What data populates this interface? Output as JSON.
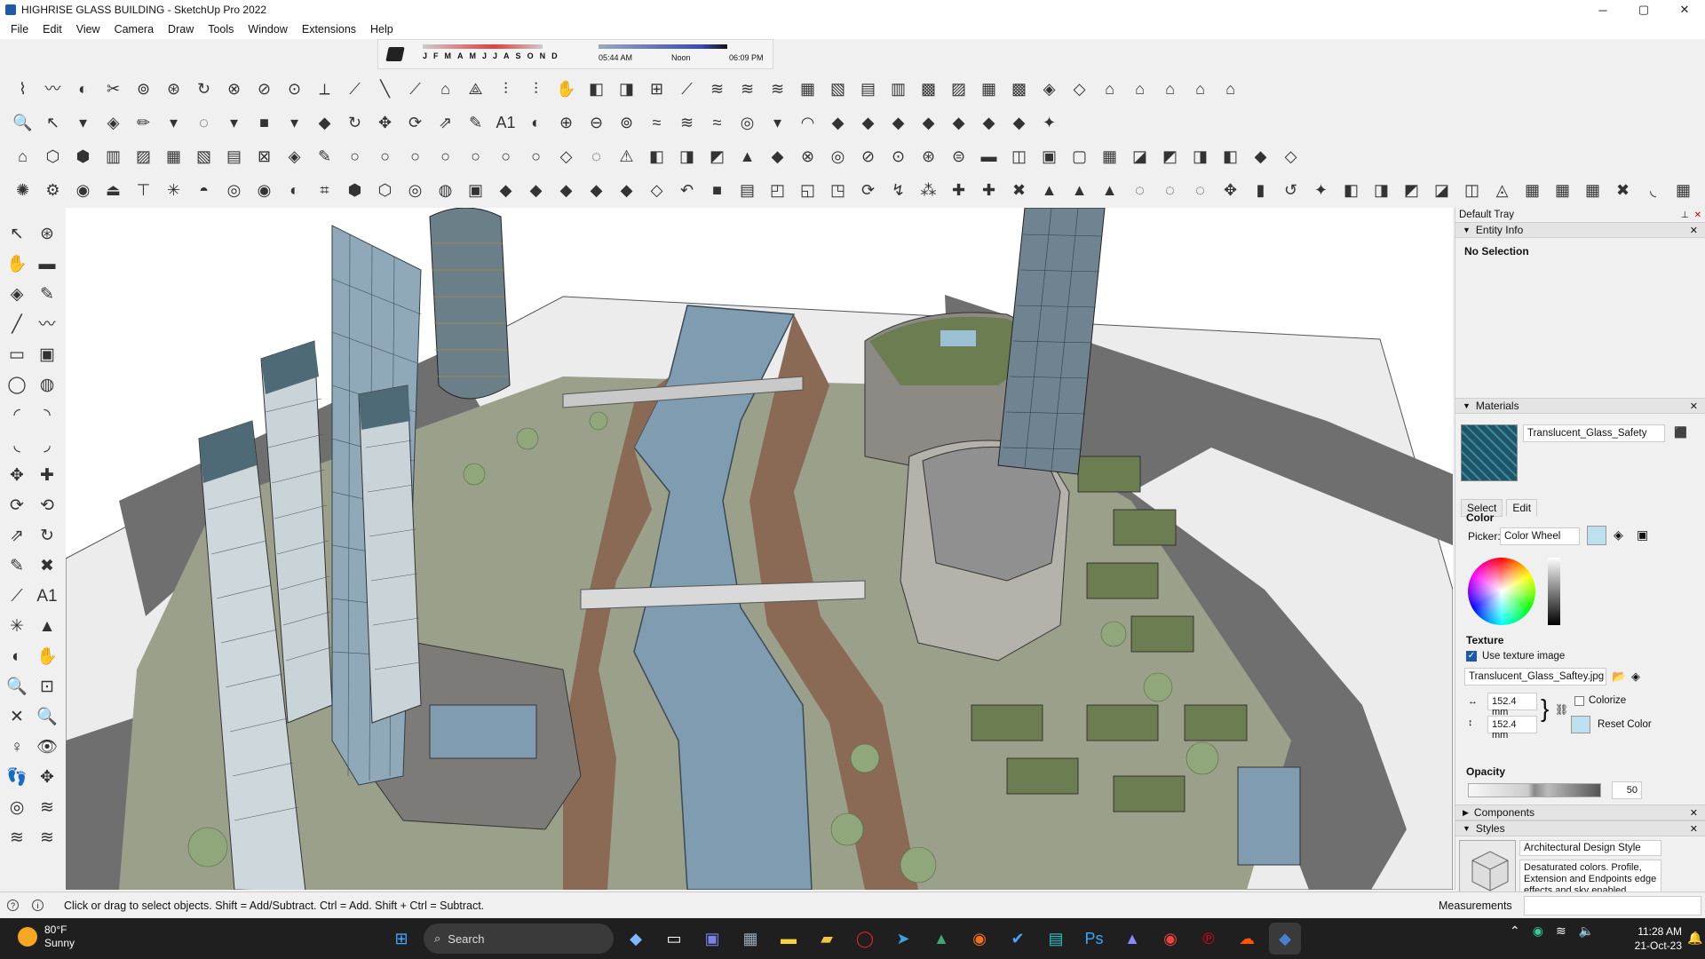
{
  "window": {
    "title": "HIGHRISE GLASS BUILDING - SketchUp Pro 2022",
    "minimize": "─",
    "maximize": "▢",
    "close": "✕"
  },
  "menu": [
    "File",
    "Edit",
    "View",
    "Camera",
    "Draw",
    "Tools",
    "Window",
    "Extensions",
    "Help"
  ],
  "shadows": {
    "months": [
      "J",
      "F",
      "M",
      "A",
      "M",
      "J",
      "J",
      "A",
      "S",
      "O",
      "N",
      "D"
    ],
    "time_start": "05:44 AM",
    "time_mid": "Noon",
    "time_end": "06:09 PM"
  },
  "toolbar_row1": [
    "⌇",
    "〰",
    "◐",
    "✂",
    "⊚",
    "⊛",
    "↻",
    "⊗",
    "⊘",
    "⊙",
    "⟂",
    "⟋",
    "╲",
    "⟋",
    "⌂",
    "⟁",
    "⫶",
    "⫶",
    "✋",
    "◧",
    "◨",
    "⊞",
    "⟋",
    "≋",
    "≋",
    "≋",
    "▦",
    "▧",
    "▤",
    "▥",
    "▩",
    "▨",
    "▦",
    "▩",
    "◈",
    "◇",
    "⌂",
    "⌂",
    "⌂",
    "⌂",
    "⌂"
  ],
  "toolbar_row2": [
    "🔍",
    "↖",
    "▾",
    "◈",
    "✏",
    "▾",
    "◌",
    "▾",
    "■",
    "▾",
    "◆",
    "↻",
    "✥",
    "⟳",
    "⇗",
    "✎",
    "A1",
    "◐",
    "⊕",
    "⊖",
    "⊚",
    "≈",
    "≋",
    "≈",
    "◎",
    "▾",
    "◠",
    "◆",
    "◆",
    "◆",
    "◆",
    "◆",
    "◆",
    "◆",
    "✦"
  ],
  "toolbar_row3": [
    "⌂",
    "⬡",
    "⬢",
    "▥",
    "▨",
    "▦",
    "▧",
    "▤",
    "⊠",
    "◈",
    "✎",
    "○",
    "○",
    "○",
    "○",
    "○",
    "○",
    "○",
    "◇",
    "◌",
    "⚠",
    "◧",
    "◨",
    "◩",
    "▲",
    "◆",
    "⊗",
    "◎",
    "⊘",
    "⊙",
    "⊛",
    "⊜",
    "▬",
    "◫",
    "▣",
    "▢",
    "▦",
    "◪",
    "◩",
    "◨",
    "◧",
    "◆",
    "◇"
  ],
  "toolbar_row4": [
    "✺",
    "⚙",
    "◉",
    "⏏",
    "⊤",
    "✳",
    "◓",
    "◎",
    "◉",
    "◐",
    "⌗",
    "⬢",
    "⬡",
    "◎",
    "◍",
    "▣",
    "◆",
    "◆",
    "◆",
    "◆",
    "◆",
    "◇",
    "↶",
    "■",
    "▤",
    "◰",
    "◱",
    "◳",
    "⟳",
    "↯",
    "⁂",
    "✚",
    "✚",
    "✖",
    "▲",
    "▲",
    "▲",
    "◌",
    "◌",
    "◌",
    "✥",
    "▮",
    "↺",
    "✦",
    "◧",
    "◨",
    "◩",
    "◪",
    "◫",
    "◬",
    "▦",
    "▦",
    "▦",
    "✖",
    "◟",
    "▦"
  ],
  "left_tools": [
    "↖",
    "⊛",
    "✋",
    "▬",
    "◈",
    "✎",
    "╱",
    "〰",
    "▭",
    "▣",
    "◯",
    "◍",
    "◜",
    "◝",
    "◟",
    "◞",
    "✥",
    "✚",
    "⟳",
    "⟲",
    "⇗",
    "↻",
    "✎",
    "✖",
    "⟋",
    "A1",
    "✳",
    "▲",
    "◐",
    "✋",
    "🔍",
    "⊡",
    "✕",
    "🔍",
    "♀",
    "👁",
    "👣",
    "✥",
    "◎",
    "≋",
    "≋",
    "≋"
  ],
  "tray": {
    "title": "Default Tray",
    "entity_info": {
      "header": "Entity Info",
      "value": "No Selection"
    },
    "materials": {
      "header": "Materials",
      "name": "Translucent_Glass_Safety",
      "tabs": [
        "Select",
        "Edit"
      ],
      "color_label": "Color",
      "picker_label": "Picker:",
      "picker_value": "Color Wheel",
      "texture_label": "Texture",
      "use_texture": "Use texture image",
      "texture_file": "Translucent_Glass_Saftey.jpg",
      "width": "152.4 mm",
      "height": "152.4 mm",
      "colorize": "Colorize",
      "reset_color": "Reset Color",
      "opacity_label": "Opacity",
      "opacity_value": "50"
    },
    "components": {
      "header": "Components"
    },
    "styles": {
      "header": "Styles",
      "name": "Architectural Design Style",
      "description": "Desaturated colors. Profile, Extension and Endpoints edge effects and sky enabled."
    }
  },
  "status": {
    "hint": "Click or drag to select objects. Shift = Add/Subtract. Ctrl = Add. Shift + Ctrl = Subtract.",
    "measurements": "Measurements"
  },
  "taskbar": {
    "weather_temp": "80°F",
    "weather_desc": "Sunny",
    "search": "Search",
    "time": "11:28 AM",
    "date": "21-Oct-23"
  },
  "colors": {
    "glass": "#8fa9b8",
    "water": "#7f9cb0",
    "road": "#6f6f6f",
    "greenroof": "#6d7d52",
    "tree": "#8fa77a",
    "accent": "#1e5aa8"
  }
}
